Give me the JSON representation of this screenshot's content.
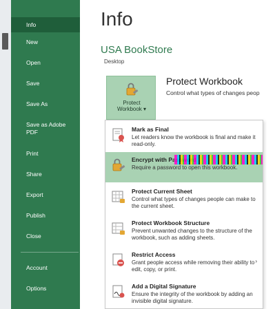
{
  "sidebar": {
    "items": [
      {
        "label": "Info",
        "active": true
      },
      {
        "label": "New"
      },
      {
        "label": "Open"
      },
      {
        "label": "Save"
      },
      {
        "label": "Save As"
      },
      {
        "label": "Save as Adobe PDF"
      },
      {
        "label": "Print"
      },
      {
        "label": "Share"
      },
      {
        "label": "Export"
      },
      {
        "label": "Publish"
      },
      {
        "label": "Close"
      },
      {
        "label": "Account"
      },
      {
        "label": "Options"
      }
    ]
  },
  "main": {
    "title": "Info",
    "doc_name": "USA BookStore",
    "doc_location": "Desktop",
    "protect": {
      "button_label_1": "Protect",
      "button_label_2": "Workbook ▾",
      "heading": "Protect Workbook",
      "description": "Control what types of changes peop"
    },
    "menu": [
      {
        "title": "Mark as Final",
        "desc": "Let readers know the workbook is final and make it read-only."
      },
      {
        "title": "Encrypt with Password",
        "desc": "Require a password to open this workbook.",
        "highlight": true
      },
      {
        "title": "Protect Current Sheet",
        "desc": "Control what types of changes people can make to the current sheet."
      },
      {
        "title": "Protect Workbook Structure",
        "desc": "Prevent unwanted changes to the structure of the workbook, such as adding sheets."
      },
      {
        "title": "Restrict Access",
        "desc": "Grant people access while removing their ability to edit, copy, or print.",
        "arrow": "›"
      },
      {
        "title": "Add a Digital Signature",
        "desc": "Ensure the integrity of the workbook by adding an invisible digital signature."
      }
    ]
  },
  "colors": {
    "sidebar": "#2f7a4f",
    "sidebar_active": "#1f5e3a",
    "accent": "#2f7a4f",
    "highlight": "#a9d2b3"
  }
}
